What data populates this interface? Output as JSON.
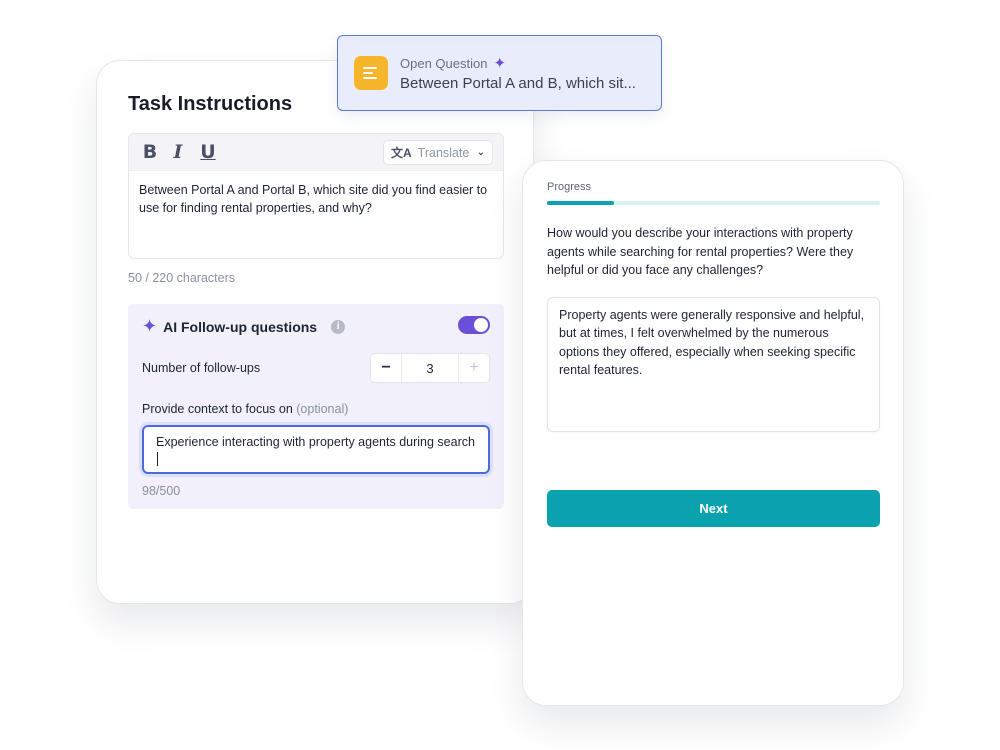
{
  "task": {
    "title": "Task Instructions",
    "toolbar": {
      "bold": "B",
      "italic": "I",
      "underline": "U",
      "translate_label": "Translate"
    },
    "instructions_text": "Between Portal A and Portal B, which site did you find easier to use for finding rental properties, and why?",
    "char_count": "50 / 220 characters"
  },
  "ai_followup": {
    "title": "AI Follow-up questions",
    "info": "i",
    "enabled": true,
    "num_label": "Number of follow-ups",
    "num_value": "3",
    "context_label": "Provide context to focus on",
    "context_optional": "(optional)",
    "context_value": "Experience interacting with property agents during search",
    "context_count": "98/500"
  },
  "open_question": {
    "type_label": "Open Question",
    "text": "Between Portal A and B, which sit..."
  },
  "survey": {
    "progress_label": "Progress",
    "progress_fraction": 0.2,
    "question": "How would you describe your interactions with property agents while searching for rental properties? Were they helpful or did you face any challenges?",
    "answer": "Property agents were generally responsive and helpful, but at times, I felt overwhelmed by the numerous options they offered, especially when seeking specific rental features.",
    "next_label": "Next"
  },
  "colors": {
    "accent_teal": "#0aa3ad",
    "accent_purple": "#6a4fd8",
    "focus_blue": "#4b6bdc",
    "question_icon": "#f7b52c"
  },
  "icons": {
    "translate": "translate-icon",
    "sparkle": "sparkle-icon",
    "info": "info-icon",
    "chevron": "chevron-down-icon",
    "open_question": "text-lines-icon"
  }
}
